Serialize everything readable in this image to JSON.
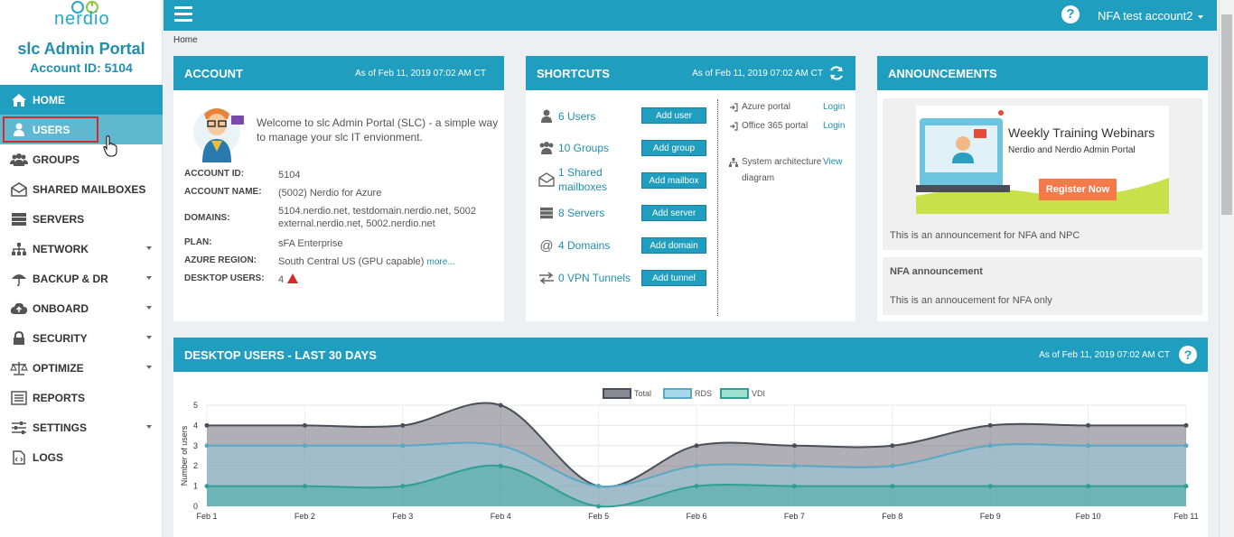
{
  "brand": {
    "logo_text": "nerdio",
    "portal_title": "slc Admin Portal",
    "account_id": "Account ID: 5104"
  },
  "nav": [
    {
      "label": "HOME",
      "icon": "home-icon",
      "caret": false
    },
    {
      "label": "USERS",
      "icon": "user-icon",
      "caret": false
    },
    {
      "label": "GROUPS",
      "icon": "groups-icon",
      "caret": false
    },
    {
      "label": "SHARED MAILBOXES",
      "icon": "mailbox-icon",
      "caret": false
    },
    {
      "label": "SERVERS",
      "icon": "servers-icon",
      "caret": false
    },
    {
      "label": "NETWORK",
      "icon": "network-icon",
      "caret": true
    },
    {
      "label": "BACKUP & DR",
      "icon": "umbrella-icon",
      "caret": true
    },
    {
      "label": "ONBOARD",
      "icon": "cloud-upload-icon",
      "caret": true
    },
    {
      "label": "SECURITY",
      "icon": "lock-icon",
      "caret": true
    },
    {
      "label": "OPTIMIZE",
      "icon": "scale-icon",
      "caret": true
    },
    {
      "label": "REPORTS",
      "icon": "list-icon",
      "caret": false
    },
    {
      "label": "SETTINGS",
      "icon": "sliders-icon",
      "caret": true
    },
    {
      "label": "LOGS",
      "icon": "code-file-icon",
      "caret": false
    }
  ],
  "topbar": {
    "help": "?",
    "account_menu": "NFA test account2"
  },
  "breadcrumb": "Home",
  "account": {
    "title": "ACCOUNT",
    "as_of": "As of Feb 11, 2019 07:02 AM CT",
    "welcome": "Welcome to slc Admin Portal (SLC) - a simple way to manage your slc IT envionment.",
    "rows": [
      {
        "label": "ACCOUNT ID:",
        "value": "5104"
      },
      {
        "label": "ACCOUNT NAME:",
        "value": "(5002) Nerdio for Azure"
      },
      {
        "label": "DOMAINS:",
        "value": "5104.nerdio.net, testdomain.nerdio.net, 5002 external.nerdio.net, 5002.nerdio.net"
      },
      {
        "label": "PLAN:",
        "value": "sFA Enterprise"
      },
      {
        "label": "AZURE REGION:",
        "value": "South Central US (GPU capable)"
      },
      {
        "label": "DESKTOP USERS:",
        "value": "4"
      }
    ],
    "more_link": "more..."
  },
  "shortcuts": {
    "title": "SHORTCUTS",
    "as_of": "As of Feb 11, 2019 07:02 AM CT",
    "items": [
      {
        "link": "6 Users",
        "button": "Add user",
        "icon": "user-icon"
      },
      {
        "link": "10 Groups",
        "button": "Add group",
        "icon": "groups-icon"
      },
      {
        "link": "1 Shared mailboxes",
        "button": "Add mailbox",
        "icon": "mailbox-icon"
      },
      {
        "link": "8 Servers",
        "button": "Add server",
        "icon": "servers-icon"
      },
      {
        "link": "4 Domains",
        "button": "Add domain",
        "icon": "at-icon"
      },
      {
        "link": "0 VPN Tunnels",
        "button": "Add tunnel",
        "icon": "exchange-icon"
      }
    ],
    "external": [
      {
        "name": "Azure portal",
        "action": "Login",
        "icon": "sign-in-icon"
      },
      {
        "name": "Office 365 portal",
        "action": "Login",
        "icon": "sign-in-icon"
      },
      {
        "name": "System architecture diagram",
        "action": "View",
        "icon": "sitemap-icon"
      }
    ]
  },
  "announcements": {
    "title": "ANNOUNCEMENTS",
    "webinar_title": "Weekly Training Webinars",
    "webinar_sub": "Nerdio and Nerdio Admin Portal",
    "webinar_button": "Register Now",
    "text1": "This is an announcement for NFA and NPC",
    "title2": "NFA announcement",
    "text2": "This is an annoucement for NFA only"
  },
  "colors": {
    "accent": "#1f9ebf",
    "total": "#4a4e58",
    "rds": "#a8d8ea",
    "vdi": "#3fbfa8"
  },
  "chart_panel": {
    "title": "DESKTOP USERS - LAST 30 DAYS",
    "as_of": "As of Feb 11, 2019 07:02 AM CT"
  },
  "chart_data": {
    "type": "area",
    "ylabel": "Number of users",
    "ylim": [
      0,
      5
    ],
    "categories": [
      "Feb 1",
      "Feb 2",
      "Feb 3",
      "Feb 4",
      "Feb 5",
      "Feb 6",
      "Feb 7",
      "Feb 8",
      "Feb 9",
      "Feb 10",
      "Feb 11"
    ],
    "series": [
      {
        "name": "Total",
        "values": [
          4,
          4,
          4,
          5,
          1,
          3,
          3,
          3,
          4,
          4,
          4
        ]
      },
      {
        "name": "RDS",
        "values": [
          3,
          3,
          3,
          3,
          1,
          2,
          2,
          2,
          3,
          3,
          3
        ]
      },
      {
        "name": "VDI",
        "values": [
          1,
          1,
          1,
          2,
          0,
          1,
          1,
          1,
          1,
          1,
          1
        ]
      }
    ],
    "legend": "top-center",
    "grid": true
  }
}
